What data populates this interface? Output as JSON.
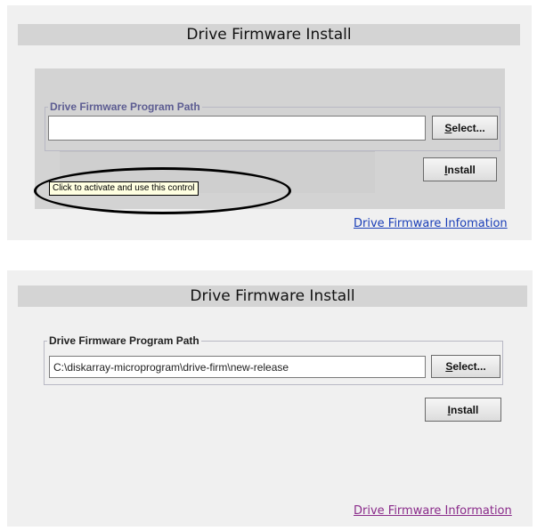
{
  "screenshots": [
    {
      "title": "Drive Firmware Install",
      "fieldset_legend": "Drive Firmware Program Path",
      "path_value": "",
      "select_button": {
        "mnemonic": "S",
        "rest": "elect..."
      },
      "install_button": {
        "mnemonic": "I",
        "rest": "nstall"
      },
      "tooltip": "Click to activate and use this control",
      "link_text": "Drive Firmware Infomation",
      "link_color": "#1a3eb8",
      "legend_color": "#5d5d92",
      "panel_color": "#d3d3d3",
      "annotation": "black-ellipse-highlight"
    },
    {
      "title": "Drive Firmware Install",
      "fieldset_legend": "Drive Firmware Program Path",
      "path_value": "C:\\diskarray-microprogram\\drive-firm\\new-release",
      "select_button": {
        "mnemonic": "S",
        "rest": "elect..."
      },
      "install_button": {
        "mnemonic": "I",
        "rest": "nstall"
      },
      "link_text": "Drive Firmware Information",
      "link_color": "#8a2b8a"
    }
  ]
}
